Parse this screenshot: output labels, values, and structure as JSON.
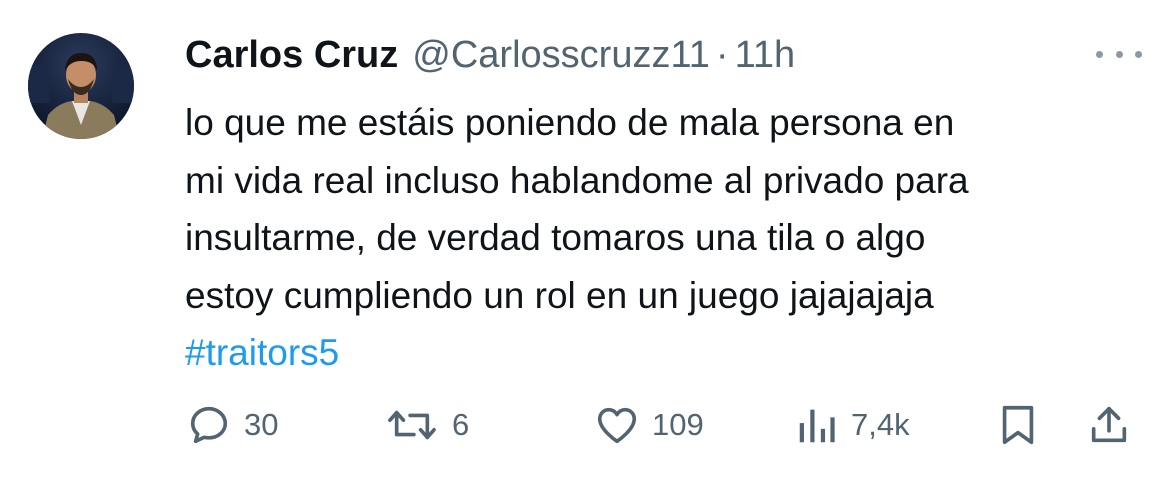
{
  "tweet": {
    "display_name": "Carlos Cruz",
    "handle": "@Carlosscruzz11",
    "separator": "·",
    "time": "11h",
    "text_lines": [
      "lo que me estáis poniendo de mala persona en",
      "mi vida real incluso hablandome al privado para",
      "insultarme,  de verdad tomaros una tila o algo",
      "estoy cumpliendo un rol en un juego jajajajaja"
    ],
    "hashtag": "#traitors5"
  },
  "actions": {
    "reply": {
      "icon": "reply-icon",
      "count": "30"
    },
    "retweet": {
      "icon": "retweet-icon",
      "count": "6"
    },
    "like": {
      "icon": "heart-icon",
      "count": "109"
    },
    "views": {
      "icon": "views-chart-icon",
      "count": "7,4k"
    },
    "bookmark": {
      "icon": "bookmark-icon"
    },
    "share": {
      "icon": "share-icon"
    }
  },
  "colors": {
    "text": "#0f1419",
    "secondary": "#536471",
    "link": "#1d9bf0",
    "background": "#ffffff"
  }
}
